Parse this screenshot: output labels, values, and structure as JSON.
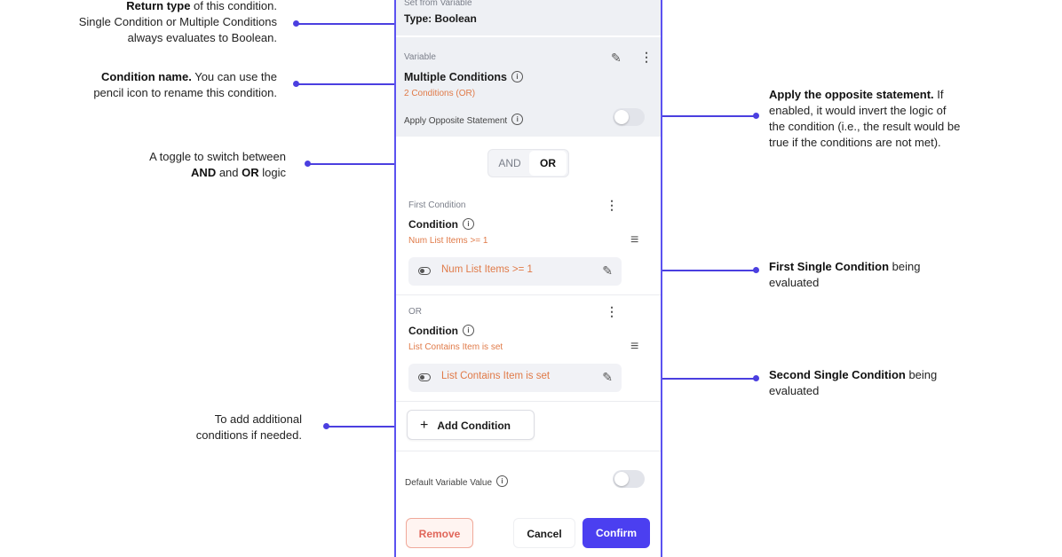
{
  "callouts": {
    "return_type": {
      "bold": "Return type",
      "text1": " of this condition.",
      "line2": "Single Condition or Multiple Conditions",
      "line3": "always evaluates to  Boolean."
    },
    "condition_name": {
      "bold": "Condition name.",
      "text1": " You can use the",
      "line2": "pencil icon to rename this condition."
    },
    "toggle": {
      "line1": "A toggle to switch between",
      "and": "AND",
      "mid": " and ",
      "or": "OR",
      "end": " logic"
    },
    "add": {
      "line1": "To add additional",
      "line2": "conditions if needed."
    },
    "opposite": {
      "bold": "Apply the opposite statement.",
      "text1": " If",
      "line2": "enabled, it would invert the logic of",
      "line3": "the condition (i.e., the result would be",
      "line4": "true if the conditions are not met)."
    },
    "first": {
      "bold": "First Single Condition",
      "text1": " being",
      "line2": "evaluated"
    },
    "second": {
      "bold": "Second Single Condition",
      "text1": " being",
      "line2": "evaluated"
    }
  },
  "panel": {
    "top_label": "Set from Variable",
    "type_label": "Type: Boolean",
    "variable_label": "Variable",
    "variable_name": "Multiple Conditions",
    "variable_sub": "2 Conditions (OR)",
    "opposite_label": "Apply Opposite Statement",
    "opposite_enabled": false,
    "logic_options": [
      "AND",
      "OR"
    ],
    "logic_selected": "OR",
    "conditions": [
      {
        "header": "First Condition",
        "title": "Condition",
        "summary": "Num List Items >= 1",
        "expression": "Num List Items >= 1"
      },
      {
        "header": "OR",
        "title": "Condition",
        "summary": "List Contains Item is set",
        "expression": "List Contains Item is set"
      }
    ],
    "add_condition": "Add Condition",
    "default_value_label": "Default Variable Value",
    "default_value_enabled": false,
    "buttons": {
      "remove": "Remove",
      "cancel": "Cancel",
      "confirm": "Confirm"
    }
  },
  "colors": {
    "accent": "#4b3ff0",
    "orange": "#e07a48",
    "remove": "#e0665a"
  },
  "icons": {
    "pencil": "pencil-icon",
    "kebab": "more-vertical-icon",
    "drag": "drag-handle-icon",
    "info": "info-icon",
    "plus": "plus-icon",
    "toggle": "toggle-icon"
  }
}
